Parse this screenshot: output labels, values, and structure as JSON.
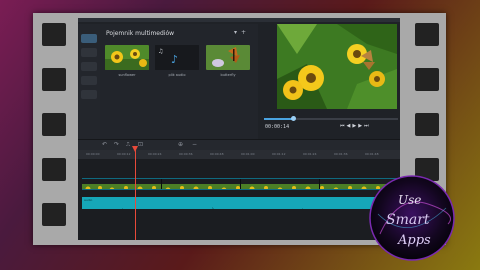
{
  "media_panel": {
    "title": "Pojemnik multimediów",
    "header_icons": [
      "filter-icon",
      "plus-icon"
    ],
    "items": [
      {
        "label": "sunflower",
        "kind": "video",
        "thumb": "sunflower"
      },
      {
        "label": "plik audio",
        "kind": "audio",
        "thumb": "audio-note"
      },
      {
        "label": "butterfly",
        "kind": "video",
        "thumb": "butterfly"
      }
    ]
  },
  "player": {
    "timecode": "00:00:14",
    "progress": 0.22,
    "controls": [
      "skip-back-icon",
      "step-back-icon",
      "play-icon",
      "step-forward-icon",
      "skip-forward-icon"
    ]
  },
  "timeline": {
    "toolbar": [
      "undo-icon",
      "redo-icon",
      "split-icon",
      "crop-icon",
      "zoom-in-icon",
      "zoom-out-icon"
    ],
    "ruler_ticks": [
      "00:00:00",
      "00:00:12",
      "00:00:24",
      "00:00:36",
      "00:00:48",
      "00:01:00",
      "00:01:12",
      "00:01:24",
      "00:01:36",
      "00:01:48"
    ],
    "video_clip_count": 4,
    "audio_label": "audio"
  },
  "colors": {
    "accent": "#4aa3e0",
    "audio": "#16a7b8",
    "playhead": "#e84a3a",
    "panel_bg": "#1f2227"
  },
  "watermark": {
    "lines": [
      "Use",
      "Smart",
      "Apps"
    ]
  }
}
